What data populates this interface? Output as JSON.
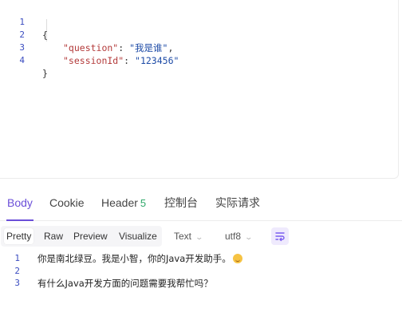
{
  "request_body": {
    "lines": [
      {
        "num": "1",
        "open": "{"
      },
      {
        "num": "2",
        "key": "\"question\"",
        "sep": ": ",
        "value": "\"我是谁\"",
        "end": ","
      },
      {
        "num": "3",
        "key": "\"sessionId\"",
        "sep": ": ",
        "value": "\"123456\"",
        "end": ""
      },
      {
        "num": "4",
        "close": "}"
      }
    ]
  },
  "response_tabs": {
    "body": "Body",
    "cookie": "Cookie",
    "header": "Header",
    "header_count": "5",
    "console": "控制台",
    "actual_request": "实际请求"
  },
  "format_toolbar": {
    "pretty": "Pretty",
    "raw": "Raw",
    "preview": "Preview",
    "visualize": "Visualize",
    "content_type": "Text",
    "encoding": "utf8",
    "wrap_icon": "wrap-lines-icon"
  },
  "response_body": {
    "lines": [
      {
        "num": "1",
        "text": "你是南北绿豆。我是小智，你的Java开发助手。",
        "emoji": "smiling-face-icon"
      },
      {
        "num": "2",
        "text": ""
      },
      {
        "num": "3",
        "text": "有什么Java开发方面的问题需要我帮忙吗？"
      }
    ]
  },
  "colors": {
    "accent": "#6b4fd8",
    "line_number": "#3a4cc0",
    "json_key": "#b33a3a",
    "json_string": "#1c4aa6",
    "badge": "#2fa86a"
  }
}
